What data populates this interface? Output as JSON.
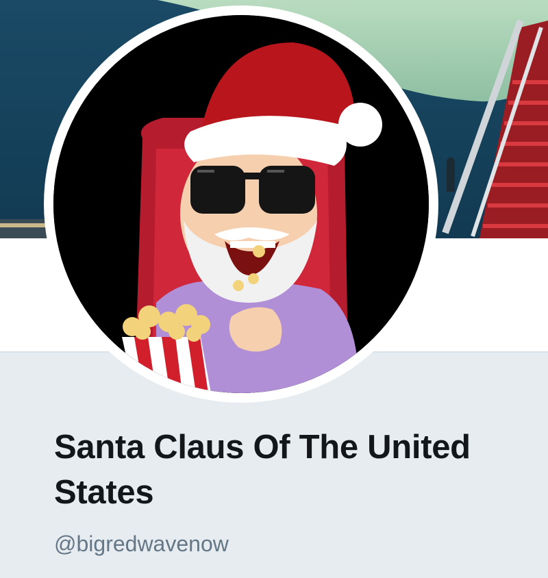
{
  "profile": {
    "display_name": "Santa Claus Of The United States",
    "handle": "@bigredwavenow",
    "avatar_description": "santa-bitmoji-eating-popcorn",
    "banner_description": "aircraft-with-red-stairs"
  },
  "colors": {
    "page_bg": "#e6ecf0",
    "name_text": "#14171a",
    "handle_text": "#657786",
    "santa_hat": "#b8161c",
    "banner_sky": "#1b4a63"
  }
}
